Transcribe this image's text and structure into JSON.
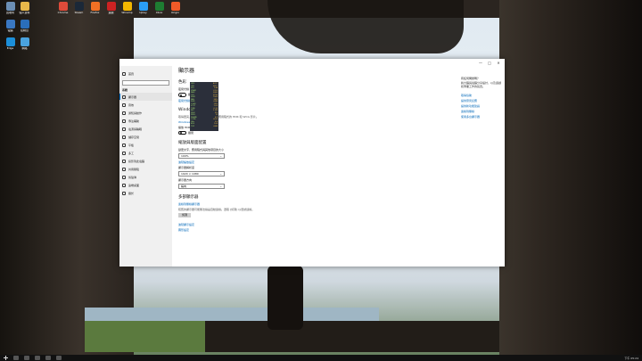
{
  "window": {
    "page_title": "顯示器",
    "color_heading": "色彩",
    "night_light_label": "夜間光線",
    "night_light_state": "關閉",
    "night_light_settings": "夜間光線設定",
    "hdr_heading": "Windows HD Color",
    "hdr_desc": "取得更亮、更生動的照片、影片和應用程式的 HDR 和 WCG 影片。",
    "hdr_link": "Windows HD Color 設定",
    "hdr_toggle_label": "播放 HDR",
    "hdr_toggle_state": "關閉",
    "scale_heading": "縮放與版面配置",
    "scale_label": "變更文字、應用程式與其他項目的大小",
    "scale_value": "100%",
    "advanced_scaling_link": "進階縮放設定",
    "resolution_label": "顯示器解析度",
    "resolution_value": "1920 × 1080",
    "orientation_label": "顯示器方向",
    "orientation_value": "橫向",
    "multi_heading": "多部顯示器",
    "multi_label": "連線到無線顯示器",
    "multi_desc": "較舊的顯示器可能無法總是自動連線。選取 [偵測] 以嘗試連線。",
    "detect_button": "偵測",
    "advanced_display_link": "進階顯示設定",
    "graphics_link": "圖形設定"
  },
  "titlebar": {
    "minimize": "—",
    "maximize": "□",
    "close": "✕"
  },
  "sidebar": {
    "home": "首頁",
    "section": "系統",
    "items": [
      {
        "label": "顯示器",
        "icon": "monitor-icon"
      },
      {
        "label": "音效",
        "icon": "speaker-icon"
      },
      {
        "label": "通知與動作",
        "icon": "notification-icon"
      },
      {
        "label": "專注輔助",
        "icon": "moon-icon"
      },
      {
        "label": "電源與睡眠",
        "icon": "power-icon"
      },
      {
        "label": "儲存空間",
        "icon": "storage-icon"
      },
      {
        "label": "平板",
        "icon": "tablet-icon"
      },
      {
        "label": "多工",
        "icon": "multitask-icon"
      },
      {
        "label": "投影到此電腦",
        "icon": "project-icon"
      },
      {
        "label": "共用體驗",
        "icon": "share-icon"
      },
      {
        "label": "剪貼簿",
        "icon": "clipboard-icon"
      },
      {
        "label": "遠端桌面",
        "icon": "remote-icon"
      },
      {
        "label": "關於",
        "icon": "info-icon"
      }
    ]
  },
  "right_panel": {
    "title": "有任何問題嗎？",
    "text": "將大腦與電腦分享設計，以及遊戲和專業工作的裝置。",
    "links": [
      "取得協助",
      "提供意見反應",
      "提供新功能建議",
      "連線到無線",
      "使用多台顯示器"
    ]
  },
  "desktop": {
    "icons": [
      {
        "label": "回收筒",
        "color": "#6b8fb5"
      },
      {
        "label": "個人資料",
        "color": "#e8b84a"
      },
      {
        "label": "電腦",
        "color": "#3a78c2"
      },
      {
        "label": "控制台",
        "color": "#2a6ebb"
      },
      {
        "label": "Edge",
        "color": "#1c8fd9"
      },
      {
        "label": "網路",
        "color": "#4aa3df"
      },
      {
        "label": "Chrome",
        "color": "#e04b3a"
      },
      {
        "label": "Steam",
        "color": "#1b2838"
      },
      {
        "label": "Firefox",
        "color": "#f27024"
      },
      {
        "label": "遊戲",
        "color": "#c22"
      },
      {
        "label": "Winamp",
        "color": "#f2b600"
      },
      {
        "label": "Uplay",
        "color": "#2a9df4"
      },
      {
        "label": "Xbox",
        "color": "#1e7d32"
      },
      {
        "label": "Origin",
        "color": "#f05a28"
      }
    ]
  },
  "overlay_rows": [
    [
      "GPU",
      "42°C"
    ],
    [
      "CPU",
      "38°C"
    ],
    [
      "FPS",
      "144"
    ],
    [
      "VRAM",
      "2.1G"
    ],
    [
      "RAM",
      "8.4G"
    ],
    [
      "CLK",
      "1750"
    ],
    [
      "MEM",
      "7000"
    ],
    [
      "FAN",
      "35%"
    ],
    [
      "PWR",
      "62W"
    ],
    [
      "LOAD",
      "12%"
    ],
    [
      "VOLT",
      "1.05"
    ],
    [
      "TIME",
      "0:12"
    ],
    [
      "NET",
      "1.2M"
    ],
    [
      "DISK",
      "3%"
    ],
    [
      "PING",
      "12"
    ],
    [
      "FRAME",
      "6.9"
    ],
    [
      "CORE",
      "4.2G"
    ],
    [
      "GHz",
      "3.6"
    ],
    [
      "BUS",
      "100"
    ],
    [
      "TDP",
      "65W"
    ]
  ],
  "taskbar": {
    "clock": "下午 05:24"
  }
}
